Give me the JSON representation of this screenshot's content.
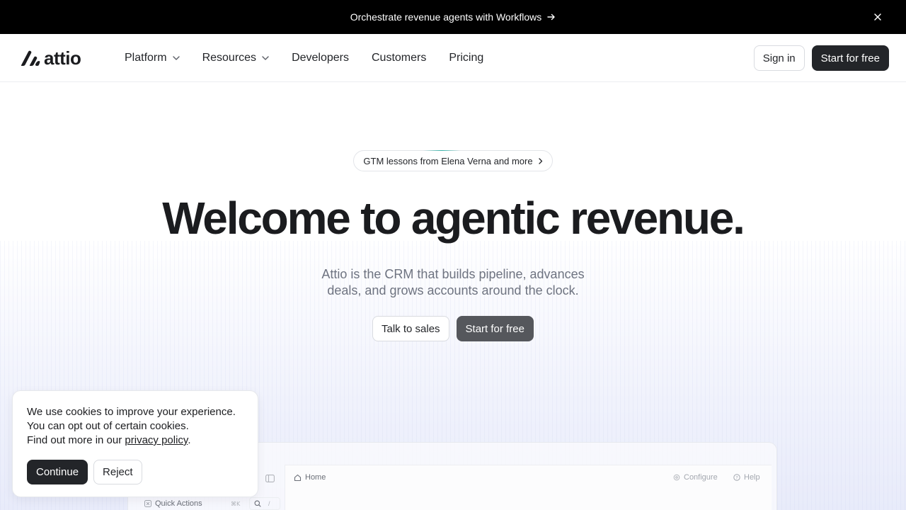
{
  "announcement": {
    "text": "Orchestrate revenue agents with Workflows",
    "arrow_icon": "arrow-right-icon",
    "close_icon": "close-icon"
  },
  "nav": {
    "logo_text": "attio",
    "items": [
      {
        "label": "Platform",
        "has_dropdown": true
      },
      {
        "label": "Resources",
        "has_dropdown": true
      },
      {
        "label": "Developers",
        "has_dropdown": false
      },
      {
        "label": "Customers",
        "has_dropdown": false
      },
      {
        "label": "Pricing",
        "has_dropdown": false
      }
    ],
    "sign_in": "Sign in",
    "start_free": "Start for free"
  },
  "hero": {
    "pill_text": "GTM lessons from Elena Verna and more",
    "headline": "Welcome to agentic revenue.",
    "subtitle": "Attio is the CRM that builds pipeline, advances deals, and grows accounts around the clock.",
    "talk_to_sales": "Talk to sales",
    "start_free": "Start for free"
  },
  "preview": {
    "home": "Home",
    "configure": "Configure",
    "help": "Help",
    "quick_actions": "Quick Actions",
    "shortcut": "⌘K",
    "search_slash": "/"
  },
  "cookie": {
    "line1": "We use cookies to improve your experience.",
    "line2": "You can opt out of certain cookies.",
    "line3_prefix": "Find out more in our",
    "link": "privacy policy",
    "line3_suffix": ".",
    "continue": "Continue",
    "reject": "Reject"
  },
  "colors": {
    "announcement_bg": "#000000",
    "primary_dark": "#232529",
    "subtitle_grey": "#6e7380",
    "pill_accent": "#36b0a6"
  }
}
